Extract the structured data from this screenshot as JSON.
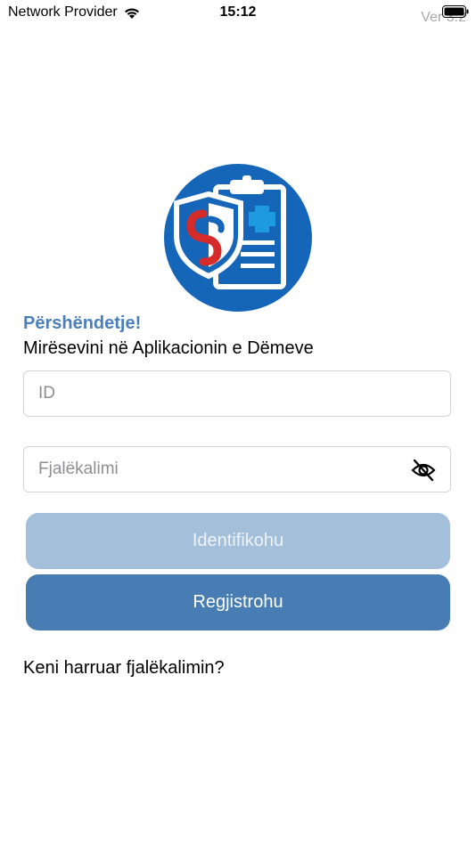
{
  "status_bar": {
    "carrier": "Network Provider",
    "time": "15:12",
    "version": "Ver 3.2",
    "wifi_icon": "wifi-icon",
    "battery_icon": "battery-icon"
  },
  "colors": {
    "accent": "#4a7fba",
    "logo_blue": "#1565b8",
    "logo_red": "#d62b2b",
    "logo_cross": "#1e9be0",
    "button_disabled": "#a3bfda",
    "button_primary": "#477db2"
  },
  "logo": {
    "icon": "insurance-claim-logo"
  },
  "header": {
    "greeting": "Përshëndetje!",
    "welcome": "Mirësevini në Aplikacionin e Dëmeve"
  },
  "form": {
    "id_value": "",
    "id_placeholder": "ID",
    "password_value": "",
    "password_placeholder": "Fjalëkalimi",
    "toggle_icon": "eye-off-icon"
  },
  "buttons": {
    "login_label": "Identifikohu",
    "register_label": "Regjistrohu"
  },
  "links": {
    "forgot_password": "Keni harruar fjalëkalimin?"
  }
}
